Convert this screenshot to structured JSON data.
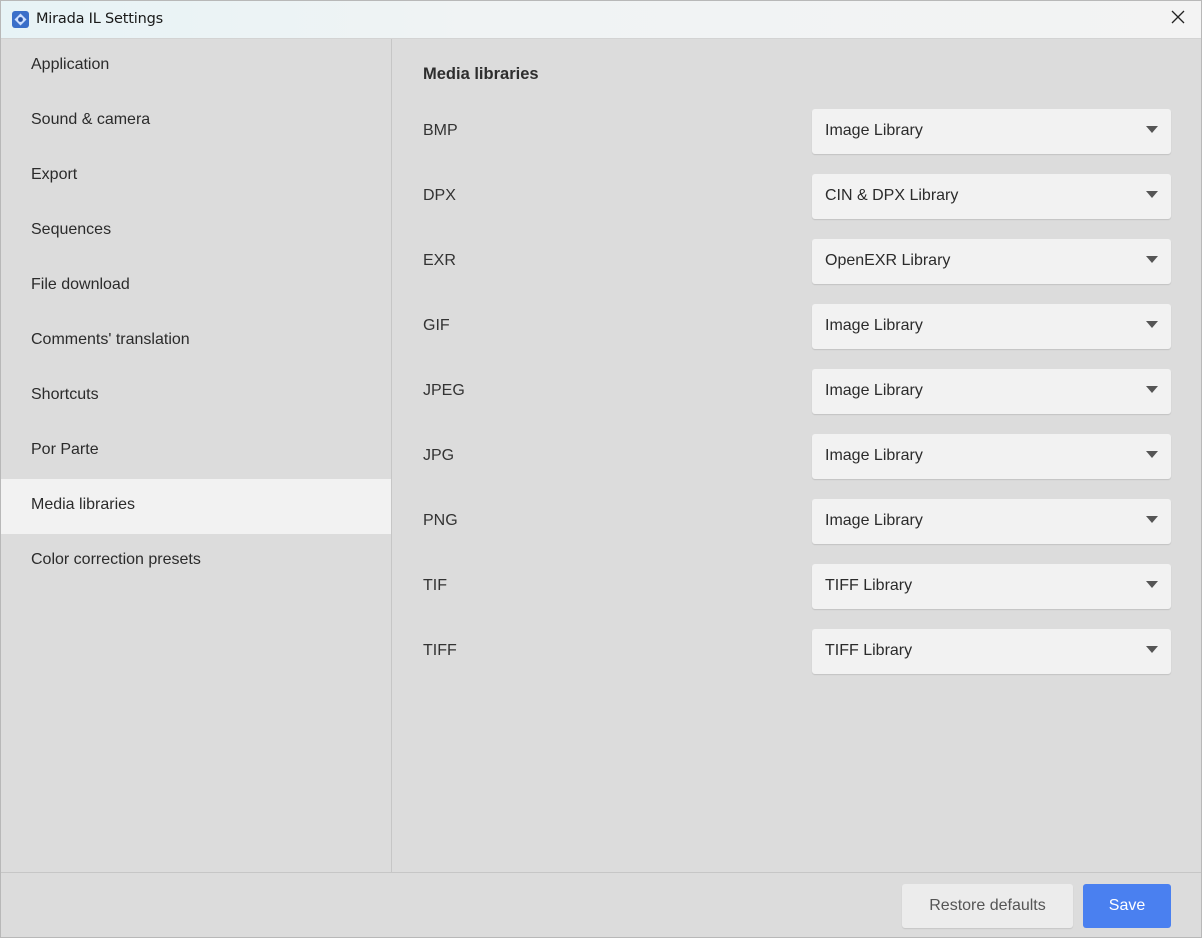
{
  "window": {
    "title": "Mirada IL Settings",
    "icon": "mirada-app-icon",
    "close_icon": "close-icon"
  },
  "sidebar": {
    "items": [
      {
        "label": "Application",
        "active": false
      },
      {
        "label": "Sound & camera",
        "active": false
      },
      {
        "label": "Export",
        "active": false
      },
      {
        "label": "Sequences",
        "active": false
      },
      {
        "label": "File download",
        "active": false
      },
      {
        "label": "Comments' translation",
        "active": false
      },
      {
        "label": "Shortcuts",
        "active": false
      },
      {
        "label": "Por Parte",
        "active": false
      },
      {
        "label": "Media libraries",
        "active": true
      },
      {
        "label": "Color correction presets",
        "active": false
      }
    ]
  },
  "main": {
    "title": "Media libraries",
    "rows": [
      {
        "format": "BMP",
        "library": "Image Library"
      },
      {
        "format": "DPX",
        "library": "CIN & DPX Library"
      },
      {
        "format": "EXR",
        "library": "OpenEXR Library"
      },
      {
        "format": "GIF",
        "library": "Image Library"
      },
      {
        "format": "JPEG",
        "library": "Image Library"
      },
      {
        "format": "JPG",
        "library": "Image Library"
      },
      {
        "format": "PNG",
        "library": "Image Library"
      },
      {
        "format": "TIF",
        "library": "TIFF Library"
      },
      {
        "format": "TIFF",
        "library": "TIFF Library"
      }
    ]
  },
  "footer": {
    "restore_label": "Restore defaults",
    "save_label": "Save"
  },
  "colors": {
    "accent": "#4a80f0",
    "background": "#dcdcdc",
    "active_item": "#f2f2f2",
    "select_bg": "#f2f2f2"
  }
}
